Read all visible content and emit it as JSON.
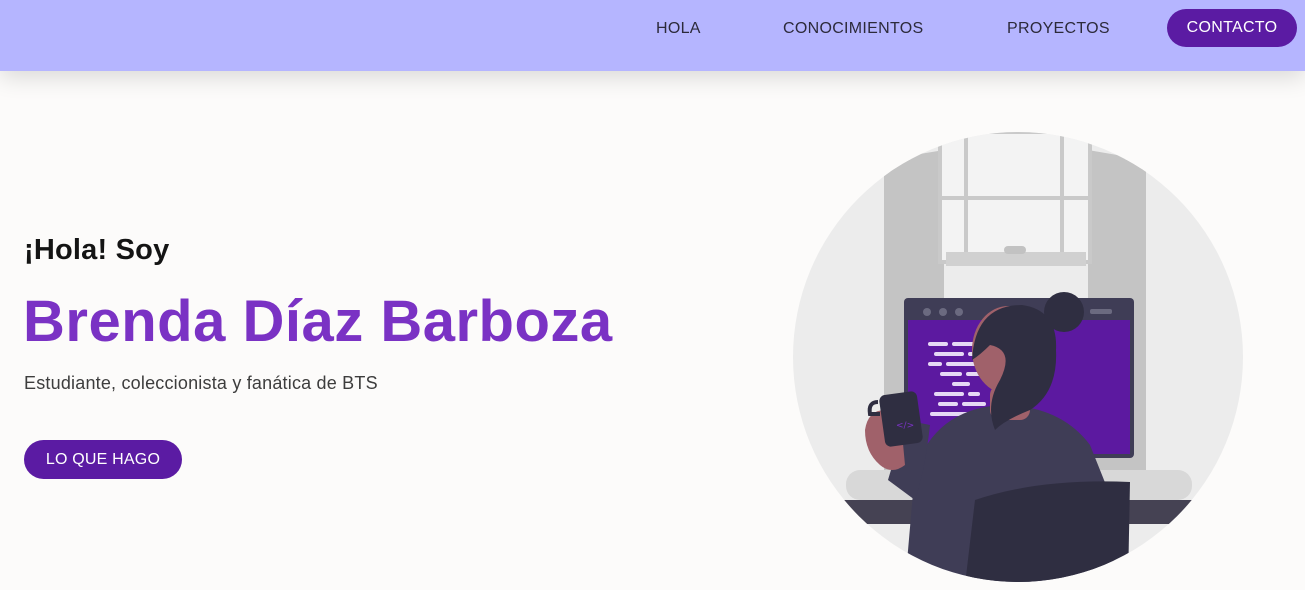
{
  "nav": {
    "items": [
      {
        "label": "HOLA"
      },
      {
        "label": "CONOCIMIENTOS"
      },
      {
        "label": "PROYECTOS"
      }
    ],
    "cta_label": "CONTACTO"
  },
  "hero": {
    "greeting": "¡Hola! Soy",
    "name": "Brenda Díaz Barboza",
    "tagline": "Estudiante, coleccionista y fanática de BTS",
    "button_label": "LO QUE HAGO"
  },
  "illustration": {
    "icon": "developer-at-computer-illustration",
    "window_lines": 12
  },
  "colors": {
    "nav_bg": "#b5b5ff",
    "accent_purple": "#7a32c4",
    "button_purple": "#5b1ba3",
    "page_bg": "#fcfbfa"
  }
}
